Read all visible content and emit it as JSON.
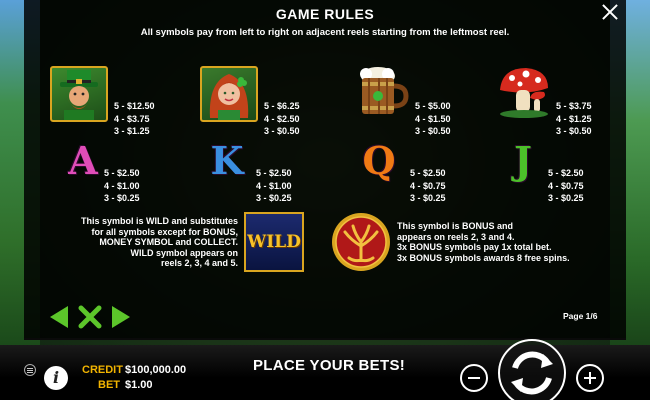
{
  "header": {
    "title": "GAME RULES",
    "subtitle": "All symbols pay from left to right on adjacent reels starting from the leftmost reel."
  },
  "symbols_row1": [
    {
      "icon": "leprechaun-icon",
      "pays": [
        "5 - $12.50",
        "4 - $3.75",
        "3 - $1.25"
      ]
    },
    {
      "icon": "red-haired-woman-icon",
      "pays": [
        "5 - $6.25",
        "4 - $2.50",
        "3 - $0.50"
      ]
    },
    {
      "icon": "beer-mug-icon",
      "pays": [
        "5 - $5.00",
        "4 - $1.50",
        "3 - $0.50"
      ]
    },
    {
      "icon": "mushroom-icon",
      "pays": [
        "5 - $3.75",
        "4 - $1.25",
        "3 - $0.50"
      ]
    }
  ],
  "symbols_row2": [
    {
      "letter": "A",
      "pays": [
        "5 - $2.50",
        "4 - $1.00",
        "3 - $0.25"
      ],
      "color": "#e04db8"
    },
    {
      "letter": "K",
      "pays": [
        "5 - $2.50",
        "4 - $1.00",
        "3 - $0.25"
      ],
      "color": "#3a8fe0"
    },
    {
      "letter": "Q",
      "pays": [
        "5 - $2.50",
        "4 - $0.75",
        "3 - $0.25"
      ],
      "color": "#f07a14"
    },
    {
      "letter": "J",
      "pays": [
        "5 - $2.50",
        "4 - $0.75",
        "3 - $0.25"
      ],
      "color": "#4cc02a"
    }
  ],
  "wild": {
    "label": "WILD",
    "description": [
      "This symbol is WILD and substitutes",
      "for all symbols except for BONUS,",
      "MONEY SYMBOL and COLLECT.",
      "WILD symbol appears on",
      "reels 2, 3, 4 and 5."
    ]
  },
  "bonus": {
    "icon": "tree-of-life-icon",
    "description": [
      "This symbol is BONUS and",
      "appears on reels 2, 3 and 4.",
      "3x BONUS symbols pay 1x total bet.",
      "3x BONUS symbols awards 8 free spins."
    ]
  },
  "navigation": {
    "page_indicator": "Page 1/6"
  },
  "bottom_bar": {
    "credit_label": "CREDIT",
    "credit_value": "$100,000.00",
    "bet_label": "BET",
    "bet_value": "$1.00",
    "message": "PLACE YOUR BETS!"
  },
  "colors": {
    "accent_green": "#5cc62a",
    "gold": "#f2b400",
    "bonus_red": "#b01818"
  }
}
